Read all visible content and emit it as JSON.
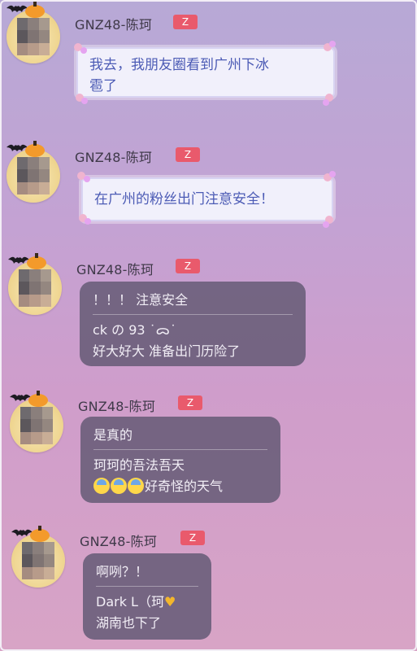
{
  "sender_name": "GNZ48-陈珂",
  "badge_label": "Z",
  "messages": [
    {
      "lines": [
        "我去，我朋友圈看到广州下冰",
        "雹了"
      ]
    },
    {
      "lines": [
        "在广州的粉丝出门注意安全！"
      ]
    },
    {
      "quote": "！！！ 注意安全",
      "lines": [
        "ck の 93 ˙ᯅ˙",
        "好大好大 准备出门历险了"
      ]
    },
    {
      "quote": "是真的",
      "lines": [
        "珂珂的吾法吾天",
        "好奇怪的天气"
      ]
    },
    {
      "quote": "啊咧？！",
      "lines": [
        "Dark L（珂",
        "湖南也下了"
      ]
    }
  ],
  "icons": [
    "bat-icon",
    "pumpkin-icon",
    "fearful-face-emoji",
    "yellow-heart-icon"
  ],
  "colors": {
    "badge": "#e95a6c",
    "light_bubble_text": "#4c5bb5",
    "dark_bubble": "#6c607c"
  }
}
